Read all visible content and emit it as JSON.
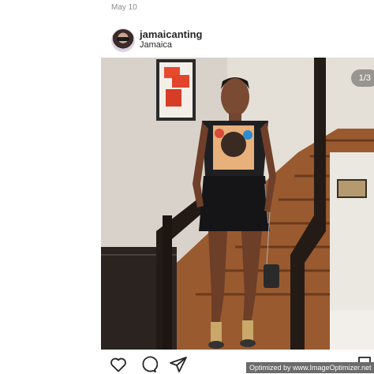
{
  "post": {
    "date": "May 10",
    "username": "jamaicanting",
    "location": "Jamaica",
    "slide_counter": "1/3"
  },
  "actions": {
    "icons": [
      "heart-icon",
      "comment-icon",
      "share-icon",
      "bookmark-icon"
    ]
  },
  "watermark": {
    "text": "Optimized by www.ImageOptimizer.net"
  },
  "colors": {
    "text_primary": "#262626",
    "text_secondary": "#8e8e8e"
  }
}
